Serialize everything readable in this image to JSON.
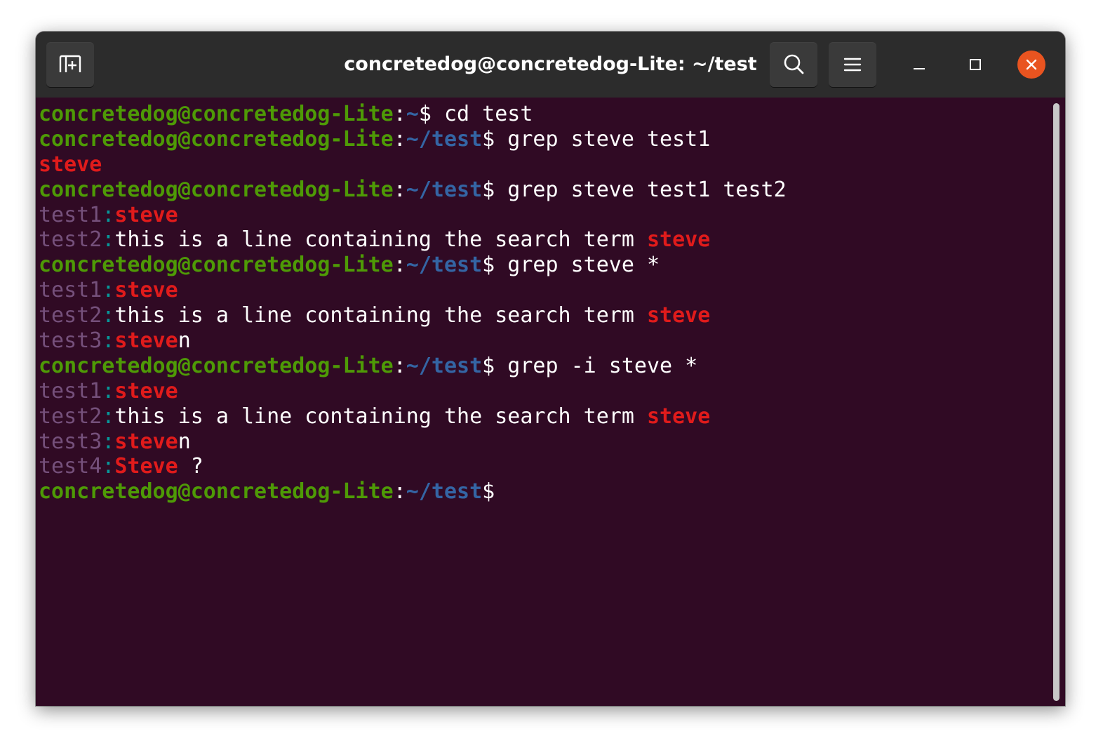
{
  "window": {
    "title": "concretedog@concretedog-Lite: ~/test"
  },
  "titlebar": {
    "new_tab_icon": "new-tab-icon",
    "search_icon": "search-icon",
    "menu_icon": "hamburger-menu-icon",
    "minimize_icon": "minimize-icon",
    "maximize_icon": "maximize-icon",
    "close_icon": "close-icon"
  },
  "colors": {
    "terminal_bg": "#300a24",
    "titlebar_bg": "#2c2c2c",
    "prompt_user": "#4e9a06",
    "prompt_path": "#3465a4",
    "grep_filename": "#75507b",
    "grep_separator": "#06989a",
    "grep_match": "#e01b1b",
    "close_button": "#e95420"
  },
  "terminal": {
    "prompt_user": "concretedog@concretedog-Lite",
    "colon": ":",
    "dollar": "$",
    "lines": [
      {
        "type": "prompt",
        "path": "~",
        "command": " cd test"
      },
      {
        "type": "prompt",
        "path": "~/test",
        "command": " grep steve test1"
      },
      {
        "type": "output",
        "parts": [
          {
            "kind": "match",
            "text": "steve"
          }
        ]
      },
      {
        "type": "prompt",
        "path": "~/test",
        "command": " grep steve test1 test2"
      },
      {
        "type": "output",
        "parts": [
          {
            "kind": "fname",
            "text": "test1"
          },
          {
            "kind": "sep",
            "text": ":"
          },
          {
            "kind": "match",
            "text": "steve"
          }
        ]
      },
      {
        "type": "output",
        "parts": [
          {
            "kind": "fname",
            "text": "test2"
          },
          {
            "kind": "sep",
            "text": ":"
          },
          {
            "kind": "plain",
            "text": "this is a line containing the search term "
          },
          {
            "kind": "match",
            "text": "steve"
          }
        ]
      },
      {
        "type": "prompt",
        "path": "~/test",
        "command": " grep steve *"
      },
      {
        "type": "output",
        "parts": [
          {
            "kind": "fname",
            "text": "test1"
          },
          {
            "kind": "sep",
            "text": ":"
          },
          {
            "kind": "match",
            "text": "steve"
          }
        ]
      },
      {
        "type": "output",
        "parts": [
          {
            "kind": "fname",
            "text": "test2"
          },
          {
            "kind": "sep",
            "text": ":"
          },
          {
            "kind": "plain",
            "text": "this is a line containing the search term "
          },
          {
            "kind": "match",
            "text": "steve"
          }
        ]
      },
      {
        "type": "output",
        "parts": [
          {
            "kind": "fname",
            "text": "test3"
          },
          {
            "kind": "sep",
            "text": ":"
          },
          {
            "kind": "match",
            "text": "steve"
          },
          {
            "kind": "plain",
            "text": "n"
          }
        ]
      },
      {
        "type": "prompt",
        "path": "~/test",
        "command": " grep -i steve *"
      },
      {
        "type": "output",
        "parts": [
          {
            "kind": "fname",
            "text": "test1"
          },
          {
            "kind": "sep",
            "text": ":"
          },
          {
            "kind": "match",
            "text": "steve"
          }
        ]
      },
      {
        "type": "output",
        "parts": [
          {
            "kind": "fname",
            "text": "test2"
          },
          {
            "kind": "sep",
            "text": ":"
          },
          {
            "kind": "plain",
            "text": "this is a line containing the search term "
          },
          {
            "kind": "match",
            "text": "steve"
          }
        ]
      },
      {
        "type": "output",
        "parts": [
          {
            "kind": "fname",
            "text": "test3"
          },
          {
            "kind": "sep",
            "text": ":"
          },
          {
            "kind": "match",
            "text": "steve"
          },
          {
            "kind": "plain",
            "text": "n"
          }
        ]
      },
      {
        "type": "output",
        "parts": [
          {
            "kind": "fname",
            "text": "test4"
          },
          {
            "kind": "sep",
            "text": ":"
          },
          {
            "kind": "match",
            "text": "Steve"
          },
          {
            "kind": "plain",
            "text": " ?"
          }
        ]
      },
      {
        "type": "prompt",
        "path": "~/test",
        "command": ""
      }
    ]
  }
}
